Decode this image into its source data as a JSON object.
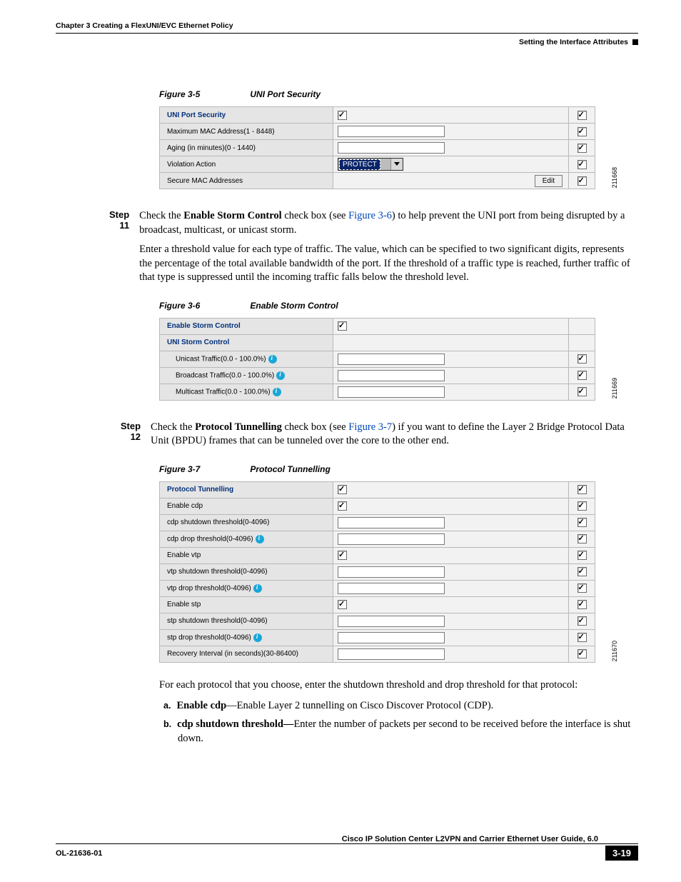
{
  "header": {
    "chapter": "Chapter 3      Creating a FlexUNI/EVC Ethernet Policy",
    "section": "Setting the Interface Attributes"
  },
  "fig35": {
    "caption_no": "Figure 3-5",
    "caption_title": "UNI Port Security",
    "sideno": "211668",
    "rows": {
      "r0_label": "UNI Port Security",
      "r1_label": "Maximum MAC Address(1 - 8448)",
      "r2_label": "Aging (in minutes)(0 - 1440)",
      "r3_label": "Violation Action",
      "r3_select": "PROTECT",
      "r4_label": "Secure MAC Addresses",
      "r4_btn": "Edit"
    }
  },
  "step11": {
    "label": "Step 11",
    "p1_a": "Check the ",
    "p1_b": "Enable Storm Control",
    "p1_c": " check box (see ",
    "p1_link": "Figure 3-6",
    "p1_d": ") to help prevent the UNI port from being disrupted by a broadcast, multicast, or unicast storm.",
    "p2": "Enter a threshold value for each type of traffic. The value, which can be specified to two significant digits, represents the percentage of the total available bandwidth of the port. If the threshold of a traffic type is reached, further traffic of that type is suppressed until the incoming traffic falls below the threshold level."
  },
  "fig36": {
    "caption_no": "Figure 3-6",
    "caption_title": "Enable Storm Control",
    "sideno": "211669",
    "rows": {
      "r0_label": "Enable Storm Control",
      "r1_label": "UNI Storm Control",
      "r2_label": "Unicast Traffic(0.0 - 100.0%)",
      "r3_label": "Broadcast Traffic(0.0 - 100.0%)",
      "r4_label": "Multicast Traffic(0.0 - 100.0%)"
    }
  },
  "step12": {
    "label": "Step 12",
    "p1_a": "Check the ",
    "p1_b": "Protocol Tunnelling",
    "p1_c": " check box (see ",
    "p1_link": "Figure 3-7",
    "p1_d": ") if you want to define the Layer 2 Bridge Protocol Data Unit (BPDU) frames that can be tunneled over the core to the other end."
  },
  "fig37": {
    "caption_no": "Figure 3-7",
    "caption_title": "Protocol Tunnelling",
    "sideno": "211670",
    "rows": {
      "r0": "Protocol Tunnelling",
      "r1": "Enable cdp",
      "r2": "cdp shutdown threshold(0-4096)",
      "r3": "cdp drop threshold(0-4096)",
      "r4": "Enable vtp",
      "r5": "vtp shutdown threshold(0-4096)",
      "r6": "vtp drop threshold(0-4096)",
      "r7": "Enable stp",
      "r8": "stp shutdown threshold(0-4096)",
      "r9": "stp drop threshold(0-4096)",
      "r10": "Recovery Interval (in seconds)(30-86400)"
    }
  },
  "tail": {
    "intro": "For each protocol that you choose, enter the shutdown threshold and drop threshold for that protocol:",
    "a_m": "a.",
    "a_b": "Enable cdp",
    "a_t": "—Enable Layer 2 tunnelling on Cisco Discover Protocol (CDP).",
    "b_m": "b.",
    "b_b": "cdp shutdown threshold—",
    "b_t": "Enter the number of packets per second to be received before the interface is shut down."
  },
  "footer": {
    "title": "Cisco IP Solution Center L2VPN and Carrier Ethernet User Guide, 6.0",
    "ol": "OL-21636-01",
    "page": "3-19"
  }
}
